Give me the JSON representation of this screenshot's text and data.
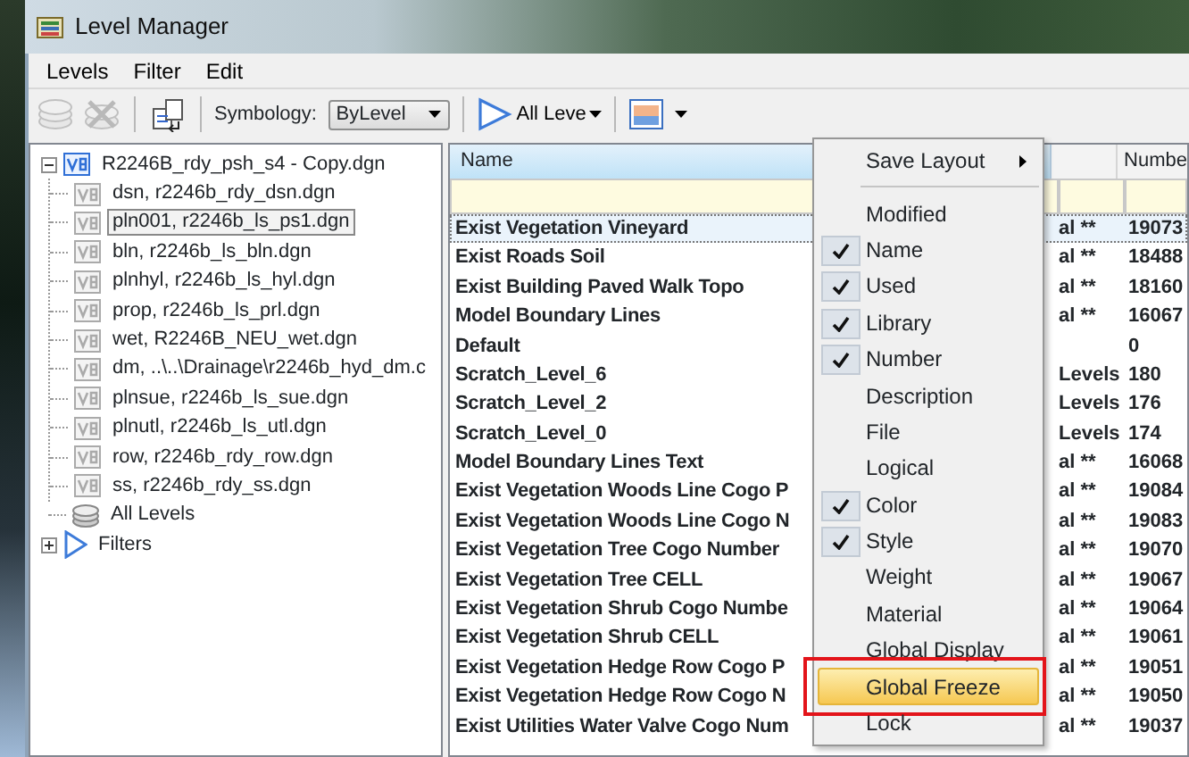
{
  "window": {
    "title": "Level Manager"
  },
  "menu_bar": [
    {
      "label": "Levels"
    },
    {
      "label": "Filter"
    },
    {
      "label": "Edit"
    }
  ],
  "toolbar": {
    "tools": [
      {
        "kind": "new-level",
        "disabled": true
      },
      {
        "kind": "delete-level",
        "disabled": true
      },
      {
        "kind": "import",
        "disabled": false
      }
    ],
    "symbology_label": "Symbology:",
    "symbology_value": "ByLevel",
    "filter_value": "All Leve"
  },
  "tree": [
    {
      "kind": "file",
      "label": "R2246B_rdy_psh_s4 - Copy.dgn",
      "expanded": true,
      "selected": false,
      "children": [
        {
          "kind": "reference",
          "label": "dsn, r2246b_rdy_dsn.dgn",
          "selected": false
        },
        {
          "kind": "reference",
          "label": "pln001, r2246b_ls_ps1.dgn",
          "selected": true
        },
        {
          "kind": "reference",
          "label": "bln, r2246b_ls_bln.dgn",
          "selected": false
        },
        {
          "kind": "reference",
          "label": "plnhyl, r2246b_ls_hyl.dgn",
          "selected": false
        },
        {
          "kind": "reference",
          "label": "prop, r2246b_ls_prl.dgn",
          "selected": false
        },
        {
          "kind": "reference",
          "label": "wet, R2246B_NEU_wet.dgn",
          "selected": false
        },
        {
          "kind": "reference",
          "label": "dm, ..\\..\\Drainage\\r2246b_hyd_dm.c",
          "selected": false
        },
        {
          "kind": "reference",
          "label": "plnsue, r2246b_ls_sue.dgn",
          "selected": false
        },
        {
          "kind": "reference",
          "label": "plnutl, r2246b_ls_utl.dgn",
          "selected": false
        },
        {
          "kind": "reference",
          "label": "row, r2246b_rdy_row.dgn",
          "selected": false
        },
        {
          "kind": "reference",
          "label": "ss, r2246b_rdy_ss.dgn",
          "selected": false
        }
      ]
    },
    {
      "kind": "levels",
      "label": "All Levels",
      "selected": false
    },
    {
      "kind": "filters",
      "label": "Filters",
      "expanded": false,
      "selected": false
    }
  ],
  "table": {
    "columns": {
      "name": "Name",
      "number": "Numbe"
    },
    "rows": [
      {
        "name": "Exist Vegetation Vineyard",
        "column_2": "al **",
        "number": "19073",
        "selected": true
      },
      {
        "name": "Exist Roads Soil",
        "column_2": "al **",
        "number": "18488",
        "selected": false
      },
      {
        "name": "Exist Building Paved Walk Topo",
        "column_2": "al **",
        "number": "18160",
        "selected": false
      },
      {
        "name": "Model Boundary Lines",
        "column_2": "al **",
        "number": "16067",
        "selected": false
      },
      {
        "name": "Default",
        "number": "0",
        "selected": false
      },
      {
        "name": "Scratch_Level_6",
        "column_2": "Levels",
        "number": "180",
        "selected": false
      },
      {
        "name": "Scratch_Level_2",
        "column_2": "Levels",
        "number": "176",
        "selected": false
      },
      {
        "name": "Scratch_Level_0",
        "column_2": "Levels",
        "number": "174",
        "selected": false
      },
      {
        "name": "Model Boundary Lines Text",
        "column_2": "al **",
        "number": "16068",
        "selected": false
      },
      {
        "name": "Exist Vegetation Woods Line Cogo P",
        "column_2": "al **",
        "number": "19084",
        "selected": false
      },
      {
        "name": "Exist Vegetation Woods Line Cogo N",
        "column_2": "al **",
        "number": "19083",
        "selected": false
      },
      {
        "name": "Exist Vegetation Tree Cogo Number",
        "column_2": "al **",
        "number": "19070",
        "selected": false
      },
      {
        "name": "Exist Vegetation Tree CELL",
        "column_2": "al **",
        "number": "19067",
        "selected": false
      },
      {
        "name": "Exist Vegetation Shrub Cogo Numbe",
        "column_2": "al **",
        "number": "19064",
        "selected": false
      },
      {
        "name": "Exist Vegetation Shrub CELL",
        "column_2": "al **",
        "number": "19061",
        "selected": false
      },
      {
        "name": "Exist Vegetation Hedge Row Cogo P",
        "column_2": "al **",
        "number": "19051",
        "selected": false
      },
      {
        "name": "Exist Vegetation Hedge Row Cogo N",
        "column_2": "al **",
        "number": "19050",
        "selected": false
      },
      {
        "name": "Exist Utilities Water Valve Cogo Num",
        "column_2": "al **",
        "number": "19037",
        "selected": false
      }
    ]
  },
  "context_menu": {
    "items": [
      {
        "kind": "submenu",
        "label": "Save Layout",
        "selected": false
      },
      {
        "kind": "separator"
      },
      {
        "kind": "toggle",
        "label": "Modified",
        "checked": false,
        "selected": false
      },
      {
        "kind": "toggle",
        "label": "Name",
        "checked": true,
        "selected": false
      },
      {
        "kind": "toggle",
        "label": "Used",
        "checked": true,
        "selected": false
      },
      {
        "kind": "toggle",
        "label": "Library",
        "checked": true,
        "selected": false
      },
      {
        "kind": "toggle",
        "label": "Number",
        "checked": true,
        "selected": false
      },
      {
        "kind": "toggle",
        "label": "Description",
        "checked": false,
        "selected": false
      },
      {
        "kind": "toggle",
        "label": "File",
        "checked": false,
        "selected": false
      },
      {
        "kind": "toggle",
        "label": "Logical",
        "checked": false,
        "selected": false
      },
      {
        "kind": "toggle",
        "label": "Color",
        "checked": true,
        "selected": false
      },
      {
        "kind": "toggle",
        "label": "Style",
        "checked": true,
        "selected": false
      },
      {
        "kind": "toggle",
        "label": "Weight",
        "checked": false,
        "selected": false
      },
      {
        "kind": "toggle",
        "label": "Material",
        "checked": false,
        "selected": false
      },
      {
        "kind": "toggle",
        "label": "Global Display",
        "checked": false,
        "selected": false
      },
      {
        "kind": "toggle",
        "label": "Global Freeze",
        "checked": false,
        "selected": true,
        "annotated": true
      },
      {
        "kind": "toggle",
        "label": "Lock",
        "checked": false,
        "selected": false
      }
    ]
  }
}
